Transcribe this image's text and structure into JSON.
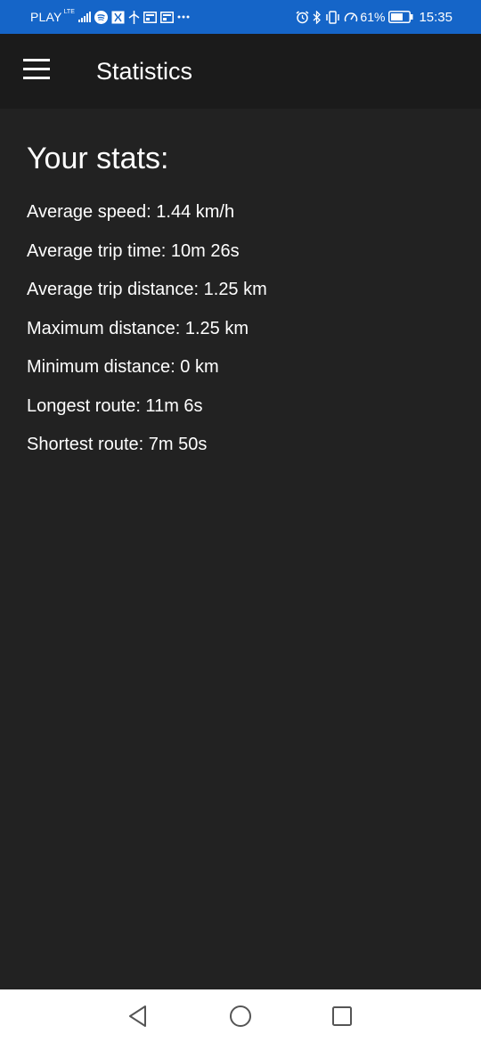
{
  "status_bar": {
    "carrier": "PLAY",
    "network": "LTE",
    "battery_percent": "61%",
    "time": "15:35",
    "icons": [
      "signal-icon",
      "spotify-icon",
      "app-icon",
      "flight-icon",
      "news-icon",
      "news-icon",
      "more-icon",
      "alarm-icon",
      "bluetooth-icon",
      "vibrate-icon",
      "speed-icon",
      "battery-icon"
    ]
  },
  "app_bar": {
    "title": "Statistics",
    "menu_icon": "hamburger-menu-icon"
  },
  "stats": {
    "heading": "Your stats:",
    "items": [
      "Average speed: 1.44 km/h",
      "Average trip time: 10m 26s",
      "Average trip distance: 1.25 km",
      "Maximum distance: 1.25 km",
      "Minimum distance: 0 km",
      "Longest route: 11m 6s",
      "Shortest route: 7m 50s"
    ]
  },
  "nav_bar": {
    "buttons": [
      "back-icon",
      "home-icon",
      "recents-icon"
    ]
  },
  "colors": {
    "status_bar": "#1565c8",
    "app_bar": "#1b1b1b",
    "background": "#222222",
    "text": "#ffffff",
    "nav_bar": "#ffffff"
  }
}
